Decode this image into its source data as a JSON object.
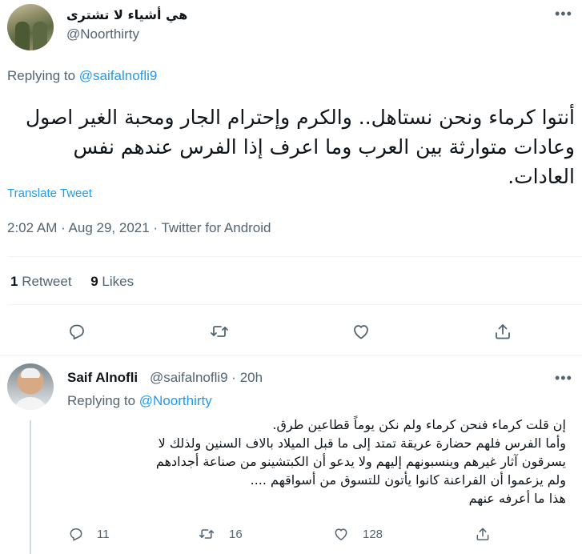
{
  "tweet": {
    "display_name": "هي أشياء لا تشترى",
    "handle": "@Noorthirty",
    "replying_prefix": "Replying to",
    "replying_to": "@saifalnofli9",
    "text": "أنتوا كرماء ونحن نستاهل.. والكرم وإحترام الجار ومحبة الغير اصول وعادات متوارثة بين العرب وما اعرف إذا الفرس عندهم نفس العادات.",
    "translate_label": "Translate Tweet",
    "timestamp": "2:02 AM · Aug 29, 2021 · Twitter for Android",
    "retweets_count": "1",
    "retweets_label": "Retweet",
    "likes_count": "9",
    "likes_label": "Likes"
  },
  "reply": {
    "display_name": "Saif Alnofli",
    "handle_time": "@saifalnofli9 · 20h",
    "replying_prefix": "Replying to",
    "replying_to": "@Noorthirty",
    "lines": [
      "إن قلت كرماء فنحن كرماء ولم نكن يوماً قطاعين طرق.",
      "وأما الفرس فلهم حضارة عريقة تمتد إلى ما قبل الميلاد بالاف السنين ولذلك لا",
      "يسرقون آثار غيرهم وينسبونهم إليهم ولا يدعو أن الكبتشينو من صناعة أجدادهم",
      "ولم يزعموا أن الفراعنة كانوا يأتون للتسوق من أسواقهم ....",
      "هذا ما أعرفه عنهم"
    ],
    "replies_count": "11",
    "retweets_count": "16",
    "likes_count": "128"
  },
  "icons": {
    "more": "more-icon",
    "reply": "reply-icon",
    "retweet": "retweet-icon",
    "like": "heart-icon",
    "share": "share-icon"
  },
  "colors": {
    "link": "#1d9bf0",
    "secondary_text": "#536471",
    "divider": "#eff3f4"
  }
}
